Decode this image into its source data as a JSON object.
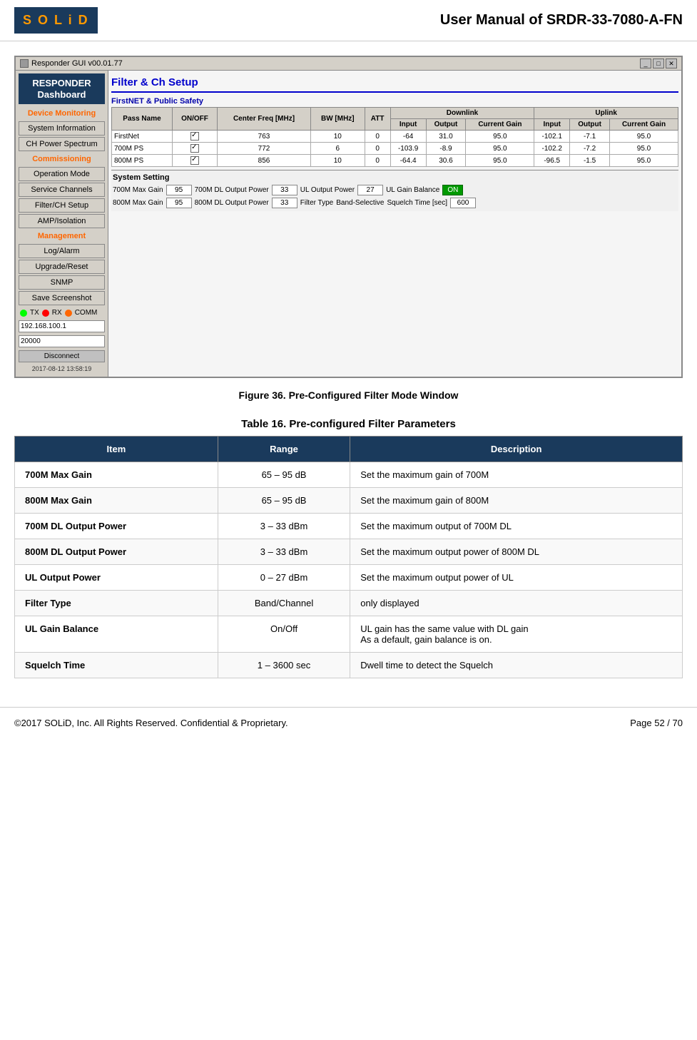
{
  "header": {
    "logo": "SOLiD",
    "title": "User Manual of SRDR-33-7080-A-FN"
  },
  "gui": {
    "titlebar": {
      "text": "Responder GUI v00.01.77",
      "controls": [
        "_",
        "□",
        "✕"
      ]
    },
    "sidebar": {
      "brand_line1": "RESPONDER",
      "brand_line2": "Dashboard",
      "device_monitoring": "Device Monitoring",
      "btn_system_info": "System Information",
      "btn_ch_power": "CH Power Spectrum",
      "commissioning": "Commissioning",
      "btn_operation": "Operation Mode",
      "btn_service": "Service Channels",
      "btn_filter": "Filter/CH Setup",
      "btn_amp": "AMP/Isolation",
      "management": "Management",
      "btn_log": "Log/Alarm",
      "btn_upgrade": "Upgrade/Reset",
      "btn_snmp": "SNMP",
      "btn_screenshot": "Save Screenshot",
      "tx_label": "TX",
      "rx_label": "RX",
      "comm_label": "COMM",
      "ip_value": "192.168.100.1",
      "port_value": "20000",
      "btn_disconnect": "Disconnect",
      "timestamp": "2017-08-12 13:58:19"
    },
    "panel": {
      "title": "Filter & Ch Setup",
      "subsection": "FirstNET & Public Safety",
      "downlink_label": "Downlink",
      "uplink_label": "Uplink",
      "table_headers": [
        "Pass Name",
        "ON/OFF",
        "Center Freq [MHz]",
        "BW [MHz]",
        "ATT",
        "Input",
        "Output",
        "Current Gain",
        "Input",
        "Output",
        "Current Gain"
      ],
      "rows": [
        {
          "name": "FirstNet",
          "on": true,
          "freq": "763",
          "bw": "10",
          "att": "0",
          "dl_input": "-64",
          "dl_output": "31.0",
          "dl_gain": "95.0",
          "ul_input": "-102.1",
          "ul_output": "-7.1",
          "ul_gain": "95.0"
        },
        {
          "name": "700M PS",
          "on": true,
          "freq": "772",
          "bw": "6",
          "att": "0",
          "dl_input": "-103.9",
          "dl_output": "-8.9",
          "dl_gain": "95.0",
          "ul_input": "-102.2",
          "ul_output": "-7.2",
          "ul_gain": "95.0"
        },
        {
          "name": "800M PS",
          "on": true,
          "freq": "856",
          "bw": "10",
          "att": "0",
          "dl_input": "-64.4",
          "dl_output": "30.6",
          "dl_gain": "95.0",
          "ul_input": "-96.5",
          "ul_output": "-1.5",
          "ul_gain": "95.0"
        }
      ],
      "system_setting_title": "System Setting",
      "sys700_label": "700M Max Gain",
      "sys700_val": "95",
      "sys800_label": "800M Max Gain",
      "sys800_val": "95",
      "dl700_label": "700M DL Output Power",
      "dl700_val": "33",
      "dl800_label": "800M DL Output Power",
      "dl800_val": "33",
      "ul_label": "UL Output Power",
      "ul_val": "27",
      "filter_label": "Filter Type",
      "filter_val": "Band-Selective",
      "ul_gain_label": "UL Gain Balance",
      "ul_gain_val": "ON",
      "squelch_label": "Squelch Time [sec]",
      "squelch_val": "600"
    }
  },
  "figure_caption": "Figure 36. Pre-Configured Filter Mode Window",
  "table_caption": "Table 16. Pre-configured Filter Parameters",
  "param_table": {
    "headers": [
      "Item",
      "Range",
      "Description"
    ],
    "rows": [
      {
        "item": "700M Max Gain",
        "range": "65 – 95 dB",
        "description": "Set the maximum gain of 700M"
      },
      {
        "item": "800M Max Gain",
        "range": "65 – 95 dB",
        "description": "Set the maximum gain of 800M"
      },
      {
        "item": "700M DL Output Power",
        "range": "3 – 33 dBm",
        "description": "Set the maximum output of 700M DL"
      },
      {
        "item": "800M DL Output Power",
        "range": "3 – 33 dBm",
        "description": "Set the maximum output power of 800M DL"
      },
      {
        "item": "UL Output Power",
        "range": "0 – 27 dBm",
        "description": "Set the maximum output power of UL"
      },
      {
        "item": "Filter Type",
        "range": "Band/Channel",
        "description": "only displayed"
      },
      {
        "item": "UL Gain Balance",
        "range": "On/Off",
        "description": "UL gain has the same value with DL gain\nAs a default, gain balance is on."
      },
      {
        "item": "Squelch Time",
        "range": "1 – 3600 sec",
        "description": "Dwell time to detect the Squelch"
      }
    ]
  },
  "footer": {
    "copyright": "©2017 SOLiD, Inc. All Rights Reserved. Confidential & Proprietary.",
    "page": "Page 52 / 70"
  }
}
